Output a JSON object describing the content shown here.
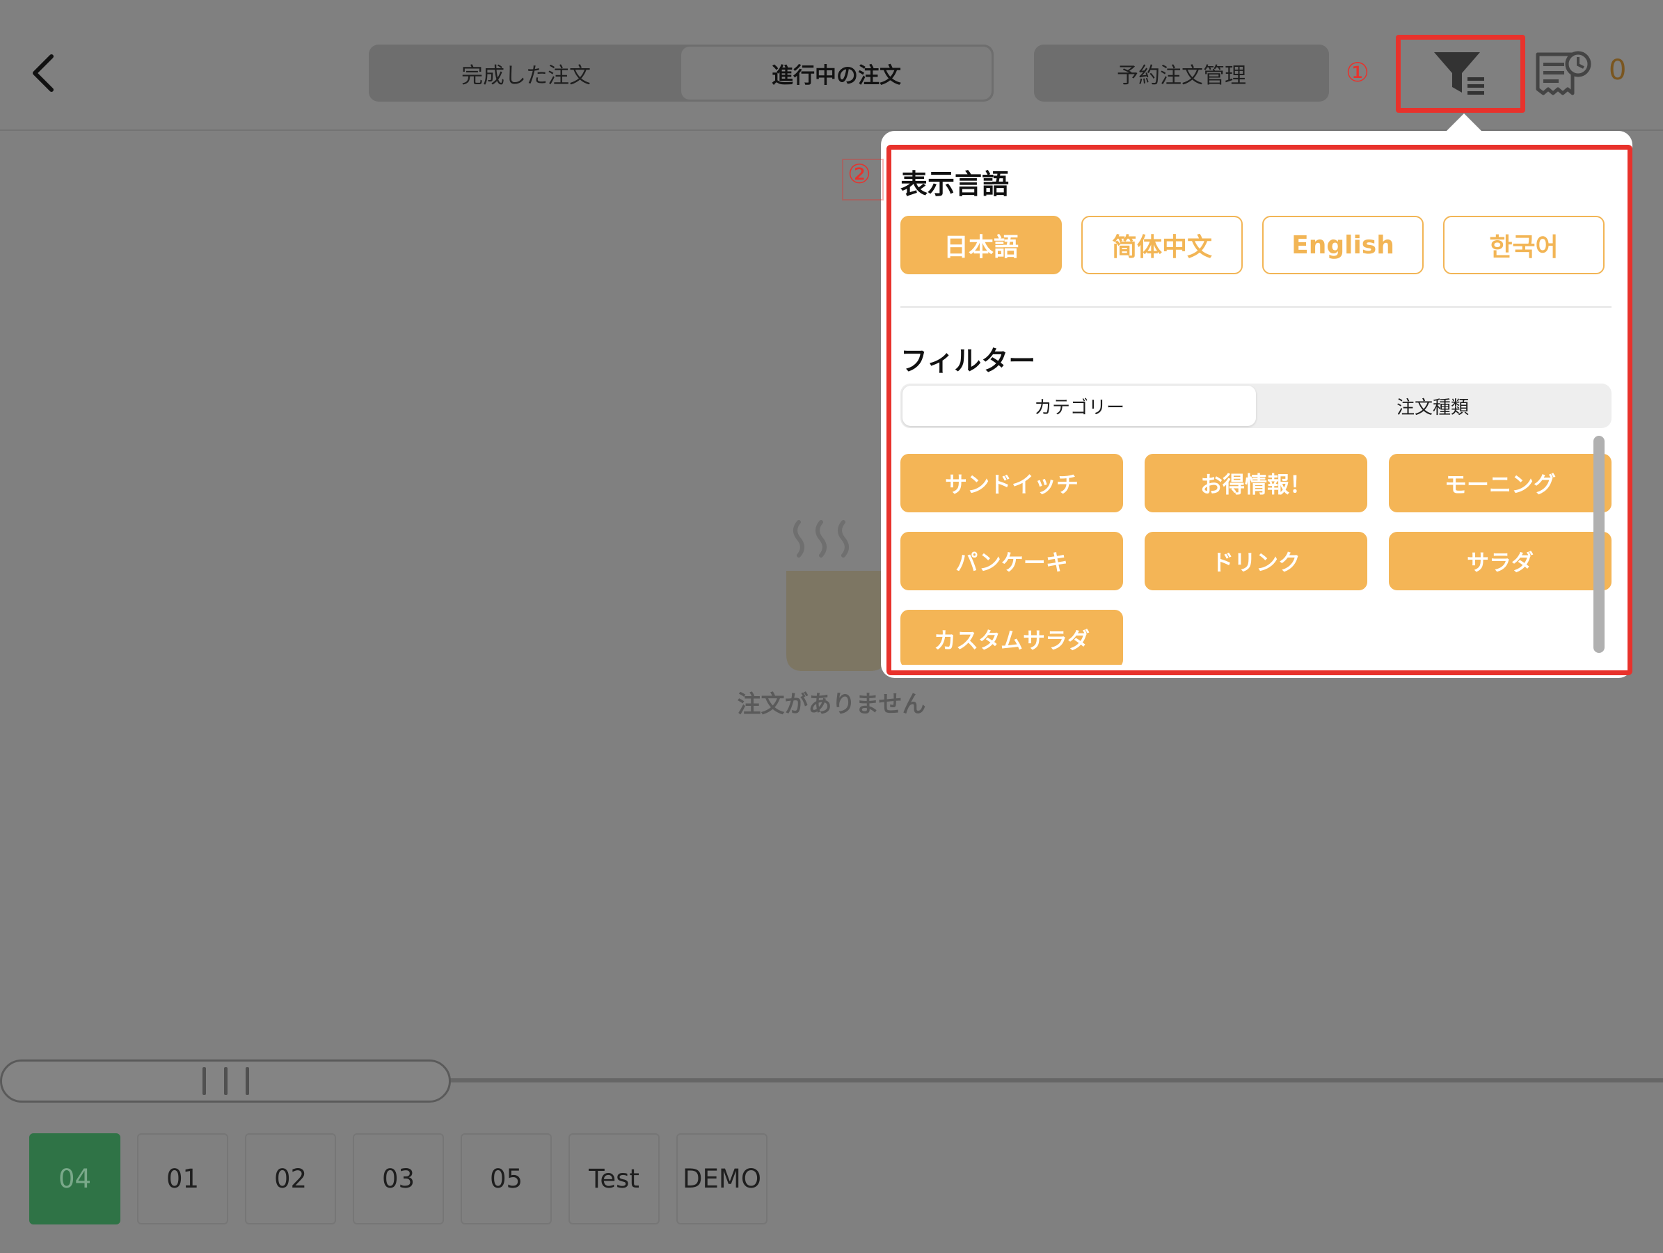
{
  "header": {
    "tabs": [
      {
        "label": "完成した注文",
        "active": false
      },
      {
        "label": "進行中の注文",
        "active": true
      }
    ],
    "reserve_label": "予約注文管理",
    "callout_1": "①",
    "receipt_count": "0",
    "icons": {
      "back": "chevron-left-icon",
      "filter": "filter-icon",
      "receipt": "receipt-clock-icon"
    }
  },
  "empty_state": {
    "icon": "steaming-cup-icon",
    "message": "注文がありません"
  },
  "tables": [
    "04",
    "01",
    "02",
    "03",
    "05",
    "Test",
    "DEMO"
  ],
  "popover": {
    "callout_2": "②",
    "language_title": "表示言語",
    "languages": [
      "日本語",
      "简体中文",
      "English",
      "한국어"
    ],
    "selected_language": "日本語",
    "filter_title": "フィルター",
    "filter_tabs": [
      "カテゴリー",
      "注文種類"
    ],
    "categories": [
      "サンドイッチ",
      "お得情報！",
      "モーニング",
      "パンケーキ",
      "ドリンク",
      "サラダ",
      "カスタムサラダ"
    ]
  },
  "colors": {
    "accent": "#f4b556",
    "active_table": "#2f7346",
    "annotation": "#e8322c"
  }
}
